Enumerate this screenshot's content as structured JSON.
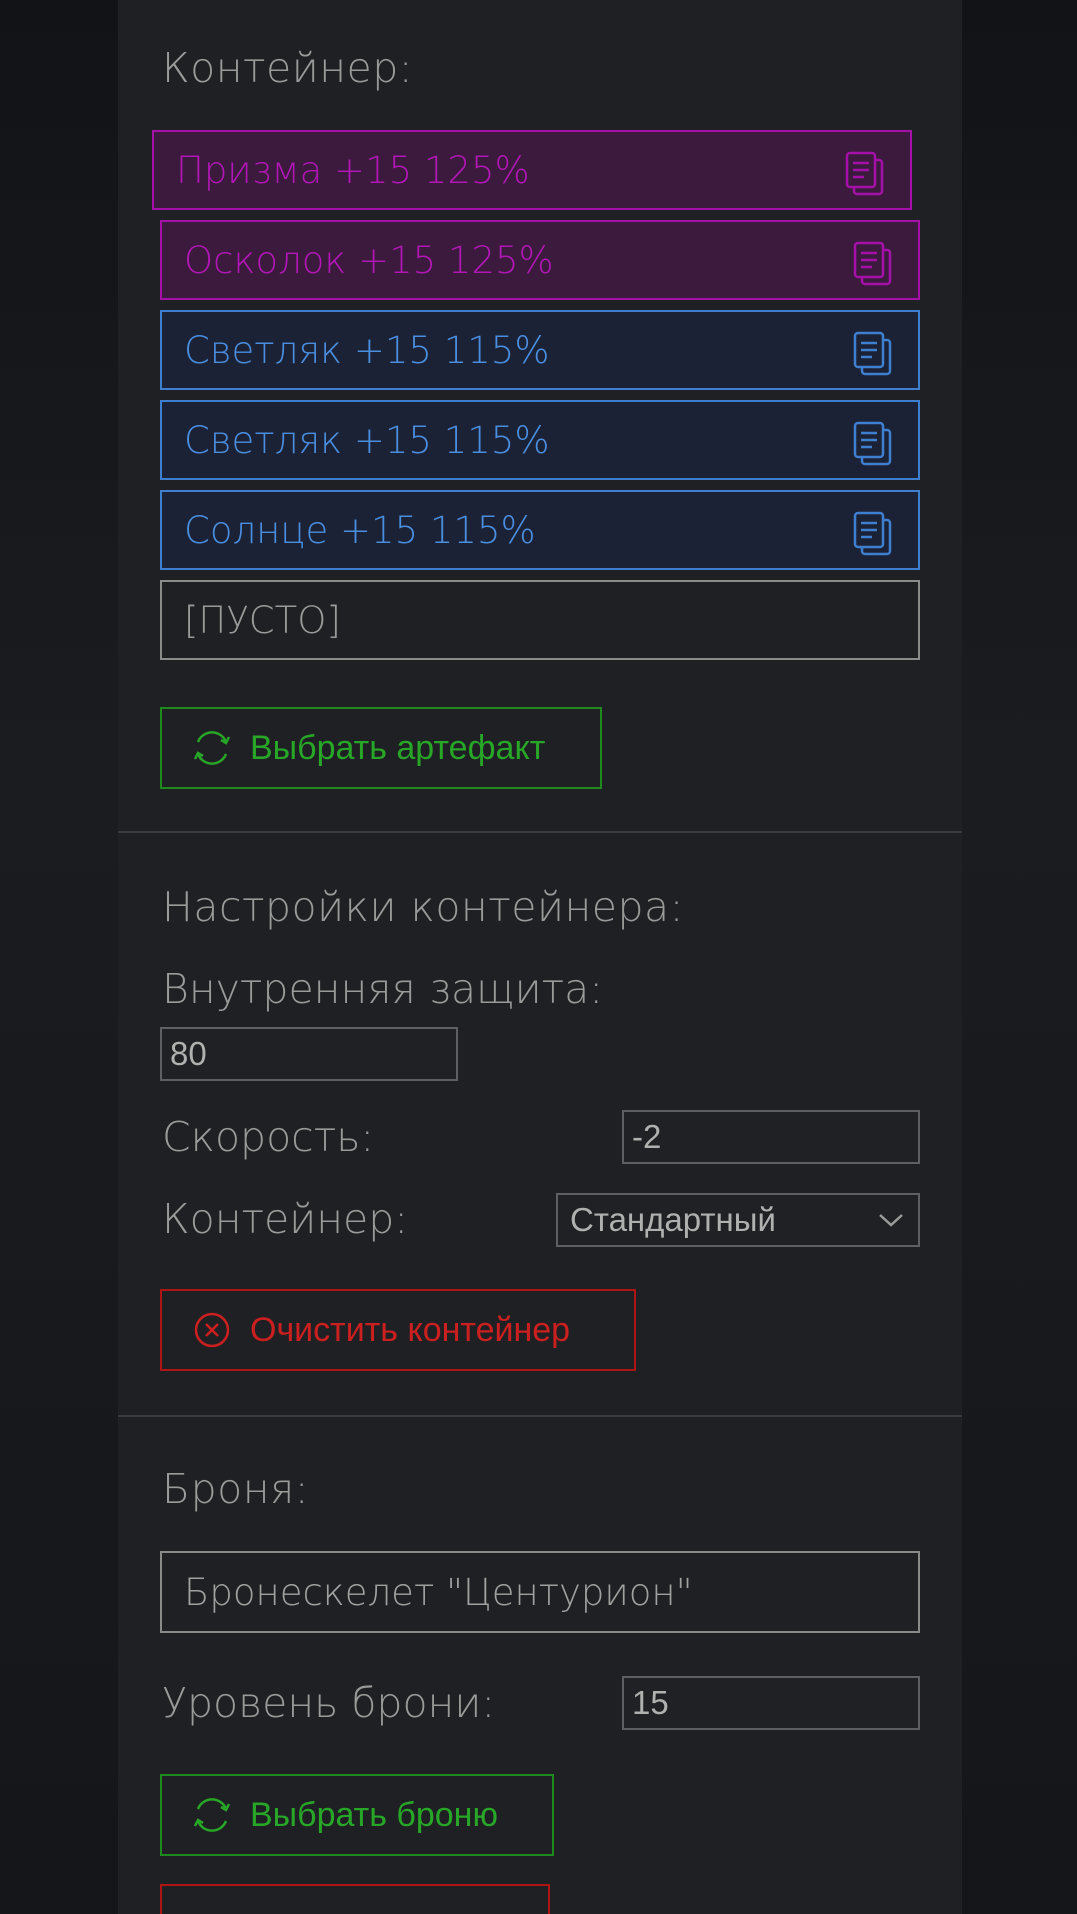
{
  "container": {
    "title": "Контейнер:",
    "slots": [
      {
        "label": "Призма +15 125%",
        "tone": "purple"
      },
      {
        "label": "Осколок +15 125%",
        "tone": "purple"
      },
      {
        "label": "Светляк +15 115%",
        "tone": "blue"
      },
      {
        "label": "Светляк +15 115%",
        "tone": "blue"
      },
      {
        "label": "Солнце +15 115%",
        "tone": "blue"
      },
      {
        "label": "[ПУСТО]",
        "tone": "empty"
      }
    ],
    "select_artifact_label": "Выбрать артефакт"
  },
  "settings": {
    "title": "Настройки контейнера:",
    "inner_protection_label": "Внутренняя защита:",
    "inner_protection_value": "80",
    "speed_label": "Скорость:",
    "speed_value": "-2",
    "container_label": "Контейнер:",
    "container_type": "Стандартный",
    "clear_label": "Очистить контейнер"
  },
  "armor": {
    "title": "Броня:",
    "name": "Бронескелет \"Центурион\"",
    "level_label": "Уровень брони:",
    "level_value": "15",
    "select_armor_label": "Выбрать броню"
  },
  "colors": {
    "purple": "#b117b4",
    "blue": "#4a8ee0",
    "green": "#27a627",
    "red": "#cc1f1f"
  },
  "icons": {
    "slot_action": "copy-icon",
    "select_action": "refresh-icon",
    "clear_action": "close-circle-icon",
    "dropdown": "chevron-down-icon"
  }
}
